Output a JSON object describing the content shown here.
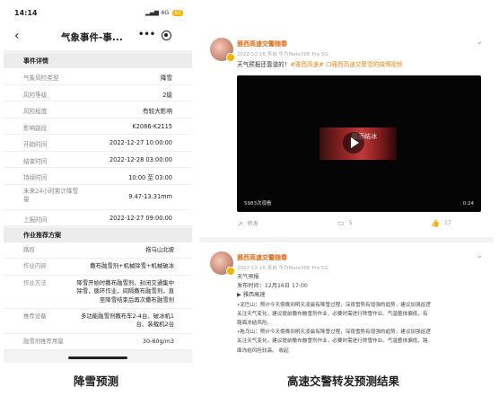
{
  "phone": {
    "status_time": "14:14",
    "status_net": "4G",
    "status_batt": "62",
    "title": "气象事件-事...",
    "more": "•••",
    "section_event": "事件详情",
    "event_rows": [
      {
        "k": "气象风险类型",
        "v": "降雪"
      },
      {
        "k": "风险等级",
        "v": "2级"
      },
      {
        "k": "风险程度",
        "v": "有较大影响"
      },
      {
        "k": "影响路段",
        "v": "K2086-K2115"
      },
      {
        "k": "开始时间",
        "v": "2022-12-27 10:00:00"
      },
      {
        "k": "结束时间",
        "v": "2022-12-28 03:00:00"
      },
      {
        "k": "持续时间",
        "v": "10:00 至 03:00"
      }
    ],
    "rain_row": {
      "k": "未来24小时累计降雪量",
      "v": "9.47-13.31mm"
    },
    "report_row": {
      "k": "上报时间",
      "v": "2022-12-27 09:00:00"
    },
    "section_plan": "作业推荐方案",
    "plan_rows": [
      {
        "k": "路段",
        "v": "拖乌山北坡"
      },
      {
        "k": "作业内容",
        "v": "撒布融雪剂+机械除雪+机械破冰"
      },
      {
        "k": "作业方法",
        "v": "降雪开始时撒布融雪剂，封闭交通集中除雪，循环作业，间隔撒布融雪剂，直至降雪结束后再次撒布融雪剂"
      },
      {
        "k": "推荐设备",
        "v": "多功能融雪剂撒布车2-4台、破冰机1台、装载机2台"
      },
      {
        "k": "融雪剂推荐用量",
        "v": "30-60g/m3"
      }
    ]
  },
  "feed": {
    "posts": [
      {
        "account": "雅西高速交警随春",
        "meta": "2022-12-16  来自 华为Mate30E Pro 5G",
        "text_plain": "天气预报还靠谱的！",
        "text_tags": "#雅西高速# 口雅西高速交警雪的微博视频",
        "video_count": "5983次观看",
        "video_duration": "0:24",
        "video_thumb_text": "路面结冰",
        "share_label": "转发",
        "comment_count": "5",
        "like_count": "17"
      },
      {
        "account": "雅西高速交警随春",
        "meta": "2022-12-16  来自 华为Mate30E Pro 5G",
        "lines": [
          "天气预报",
          "发布时间：12月16日 17:00",
          "▶ 雅西高速",
          "•泥巴山：预计今天傍晚到明天凌晨有降雪过程，深夜雪势有增强的趋势，建议加强巡逻",
          "关注天气变化，建议提前撒布融雪剂作业，必要时需进行除雪作业。气温整体偏低，有",
          "路面冻结风险。",
          "•拖乌山：预计今天傍晚到明天凌晨有降雪过程，深夜雪势有增强的趋势，建议加强巡逻",
          "关注天气变化，建议提前撒布融雪剂作业，必要时需进行除雪作业。气温整体偏低，路",
          "面冻结风险较高。 收起"
        ]
      }
    ]
  },
  "captions": {
    "left": "降雪预测",
    "right": "高速交警转发预测结果"
  },
  "colors": {
    "accent_orange": "#e06b14",
    "tag_color": "#e08a1e"
  }
}
